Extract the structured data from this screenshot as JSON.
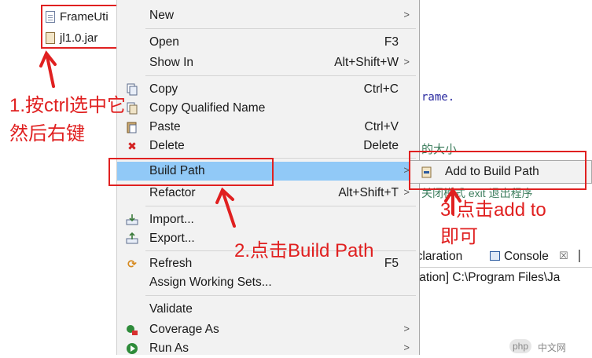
{
  "tree": {
    "items": [
      {
        "label": "FrameUti"
      },
      {
        "label": "jl1.0.jar"
      }
    ]
  },
  "editor": {
    "code_fragment_1": "rame.",
    "cn_fragment": "的大小",
    "code_fragment_2": "关闭模式 exit 退出程序"
  },
  "menu": {
    "new": {
      "label": "New"
    },
    "open": {
      "label": "Open",
      "shortcut": "F3"
    },
    "show_in": {
      "label": "Show In",
      "shortcut": "Alt+Shift+W"
    },
    "copy": {
      "label": "Copy",
      "shortcut": "Ctrl+C"
    },
    "copy_qualified": {
      "label": "Copy Qualified Name"
    },
    "paste": {
      "label": "Paste",
      "shortcut": "Ctrl+V"
    },
    "delete": {
      "label": "Delete",
      "shortcut": "Delete"
    },
    "build_path": {
      "label": "Build Path"
    },
    "refactor": {
      "label": "Refactor",
      "shortcut": "Alt+Shift+T"
    },
    "import": {
      "label": "Import..."
    },
    "export": {
      "label": "Export..."
    },
    "refresh": {
      "label": "Refresh",
      "shortcut": "F5"
    },
    "assign_ws": {
      "label": "Assign Working Sets..."
    },
    "validate": {
      "label": "Validate"
    },
    "coverage_as": {
      "label": "Coverage As"
    },
    "run_as": {
      "label": "Run As"
    }
  },
  "submenu": {
    "add_to_build_path": {
      "label": "Add to Build Path"
    }
  },
  "panel": {
    "declaration_tab": "eclaration",
    "console_tab": "Console",
    "console_close": "☒",
    "path_text": "ication] C:\\Program Files\\Ja"
  },
  "annotations": {
    "step1_line1": "1.按ctrl选中它",
    "step1_line2": "然后右键",
    "step2": "2.点击Build Path",
    "step3_line1": "3.点击add to",
    "step3_line2": "即可"
  },
  "watermark": {
    "php": "php",
    "site": "中文网"
  },
  "colors": {
    "annotation_red": "#e02020",
    "menu_highlight": "#91c9f7",
    "menu_bg": "#f2f2f2"
  }
}
